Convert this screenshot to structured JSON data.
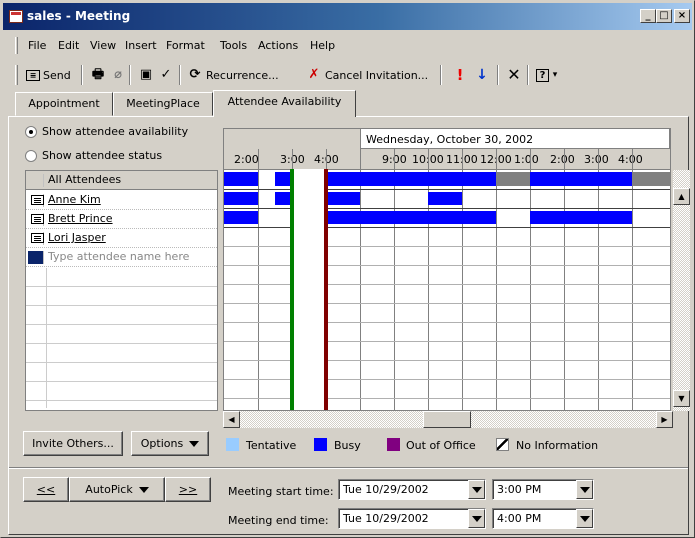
{
  "window": {
    "title": "sales - Meeting"
  },
  "menu": [
    "File",
    "Edit",
    "View",
    "Insert",
    "Format",
    "Tools",
    "Actions",
    "Help"
  ],
  "toolbar": {
    "send_label": "Send",
    "recurrence_label": "Recurrence...",
    "cancel_invitation_label": "Cancel Invitation..."
  },
  "tabs": [
    {
      "label": "Appointment"
    },
    {
      "label": "MeetingPlace"
    },
    {
      "label": "Attendee Availability"
    }
  ],
  "view_options": {
    "show_availability": "Show attendee availability",
    "show_status": "Show attendee status",
    "selected": "availability"
  },
  "attendees": {
    "header": "All Attendees",
    "rows": [
      {
        "name": "Anne Kim"
      },
      {
        "name": "Brett Prince"
      },
      {
        "name": "Lori Jasper"
      }
    ],
    "placeholder": "Type attendee name here"
  },
  "schedule": {
    "date_label": "Wednesday, October 30, 2002",
    "hour_labels": [
      "2:00",
      "3:00",
      "4:00",
      "9:00",
      "10:00",
      "11:00",
      "12:00",
      "1:00",
      "2:00",
      "3:00",
      "4:00"
    ]
  },
  "buttons": {
    "invite_others": "Invite Others...",
    "options": "Options",
    "prev": "<<",
    "autopick": "AutoPick",
    "next": ">>"
  },
  "legend": [
    {
      "label": "Tentative",
      "color": "#99ccff"
    },
    {
      "label": "Busy",
      "color": "#0000ff"
    },
    {
      "label": "Out of Office",
      "color": "#800080"
    },
    {
      "label": "No Information",
      "color": "#808080"
    }
  ],
  "meeting": {
    "start_label": "Meeting start time:",
    "start_date": "Tue 10/29/2002",
    "start_time": "3:00 PM",
    "end_label": "Meeting end time:",
    "end_date": "Tue 10/29/2002",
    "end_time": "4:00 PM"
  },
  "colors": {
    "title_bar": "#0a246a",
    "busy": "#0000ff",
    "no_info": "#808080",
    "start_marker": "#008000",
    "end_marker": "#800000"
  }
}
